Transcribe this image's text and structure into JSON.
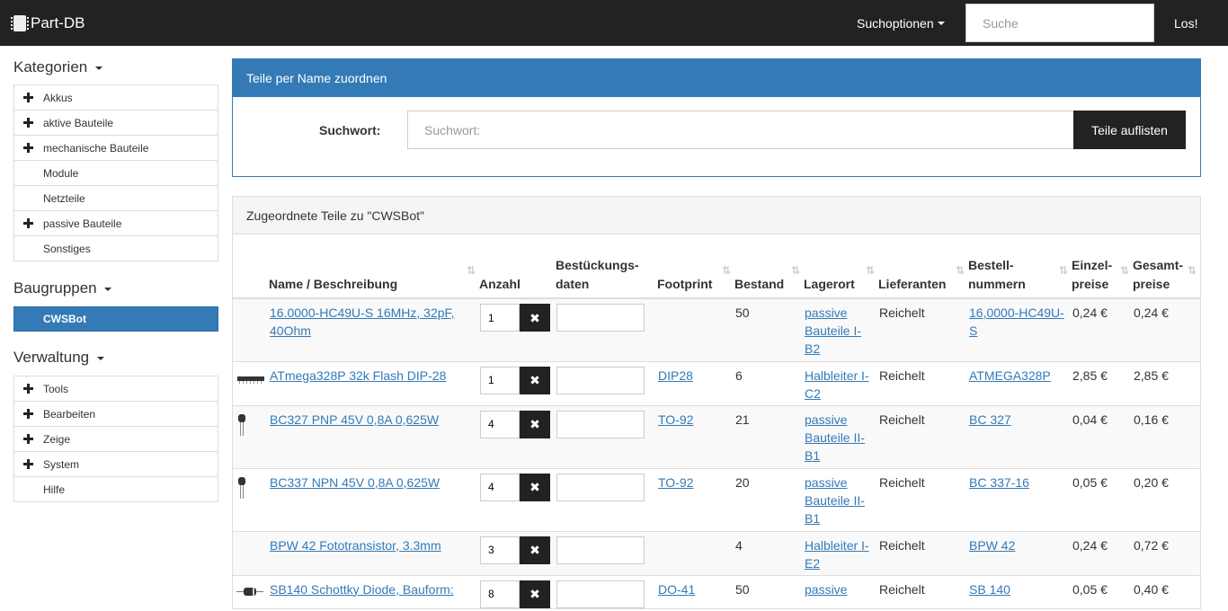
{
  "navbar": {
    "brand": "Part-DB",
    "search_options": "Suchoptionen",
    "search_placeholder": "Suche",
    "go": "Los!"
  },
  "sidebar": {
    "categories_title": "Kategorien",
    "categories": [
      {
        "label": "Akkus",
        "expandable": true
      },
      {
        "label": "aktive Bauteile",
        "expandable": true
      },
      {
        "label": "mechanische Bauteile",
        "expandable": true
      },
      {
        "label": "Module",
        "expandable": false
      },
      {
        "label": "Netzteile",
        "expandable": false
      },
      {
        "label": "passive Bauteile",
        "expandable": true
      },
      {
        "label": "Sonstiges",
        "expandable": false
      }
    ],
    "groups_title": "Baugruppen",
    "groups": [
      {
        "label": "CWSBot"
      }
    ],
    "admin_title": "Verwaltung",
    "admin": [
      {
        "label": "Tools",
        "expandable": true
      },
      {
        "label": "Bearbeiten",
        "expandable": true
      },
      {
        "label": "Zeige",
        "expandable": true
      },
      {
        "label": "System",
        "expandable": true
      },
      {
        "label": "Hilfe",
        "expandable": false
      }
    ]
  },
  "assign_panel": {
    "title": "Teile per Name zuordnen",
    "label": "Suchwort:",
    "placeholder": "Suchwort:",
    "button": "Teile auflisten"
  },
  "parts_panel": {
    "title": "Zugeordnete Teile zu \"CWSBot\"",
    "columns": {
      "name": "Name / Beschreibung",
      "qty": "Anzahl",
      "placement_1": "Bestückungs-",
      "placement_2": "daten",
      "footprint": "Footprint",
      "stock": "Bestand",
      "location": "Lagerort",
      "suppliers": "Lieferanten",
      "order_1": "Bestell-",
      "order_2": "nummern",
      "unit_1": "Einzel-",
      "unit_2": "preise",
      "total_1": "Gesamt-",
      "total_2": "preise"
    },
    "sort_glyph": "⇅",
    "remove_glyph": "✖",
    "rows": [
      {
        "name": "16.0000-HC49U-S 16MHz, 32pF, 40Ohm",
        "qty": "1",
        "footprint": "",
        "stock": "50",
        "location": "passive Bauteile I-B2",
        "supplier": "Reichelt",
        "order_no": "16,0000-HC49U-S",
        "unit_price": "0,24 €",
        "total_price": "0,24 €",
        "icon": "none"
      },
      {
        "name": "ATmega328P 32k Flash DIP-28",
        "qty": "1",
        "footprint": "DIP28",
        "stock": "6",
        "location": "Halbleiter I-C2",
        "supplier": "Reichelt",
        "order_no": "ATMEGA328P",
        "unit_price": "2,85 €",
        "total_price": "2,85 €",
        "icon": "dip-chip-icon"
      },
      {
        "name": "BC327 PNP 45V 0,8A 0,625W",
        "qty": "4",
        "footprint": "TO-92",
        "stock": "21",
        "location": "passive Bauteile II-B1",
        "supplier": "Reichelt",
        "order_no": "BC 327",
        "unit_price": "0,04 €",
        "total_price": "0,16 €",
        "icon": "transistor-icon"
      },
      {
        "name": "BC337 NPN 45V 0,8A 0,625W",
        "qty": "4",
        "footprint": "TO-92",
        "stock": "20",
        "location": "passive Bauteile II-B1",
        "supplier": "Reichelt",
        "order_no": "BC 337-16",
        "unit_price": "0,05 €",
        "total_price": "0,20 €",
        "icon": "transistor-icon"
      },
      {
        "name": "BPW 42 Fototransistor, 3.3mm",
        "qty": "3",
        "footprint": "",
        "stock": "4",
        "location": "Halbleiter I-E2",
        "supplier": "Reichelt",
        "order_no": "BPW 42",
        "unit_price": "0,24 €",
        "total_price": "0,72 €",
        "icon": "none"
      },
      {
        "name": "SB140 Schottky Diode, Bauform:",
        "qty": "8",
        "footprint": "DO-41",
        "stock": "50",
        "location": "passive",
        "supplier": "Reichelt",
        "order_no": "SB 140",
        "unit_price": "0,05 €",
        "total_price": "0,40 €",
        "icon": "diode-icon"
      }
    ]
  }
}
